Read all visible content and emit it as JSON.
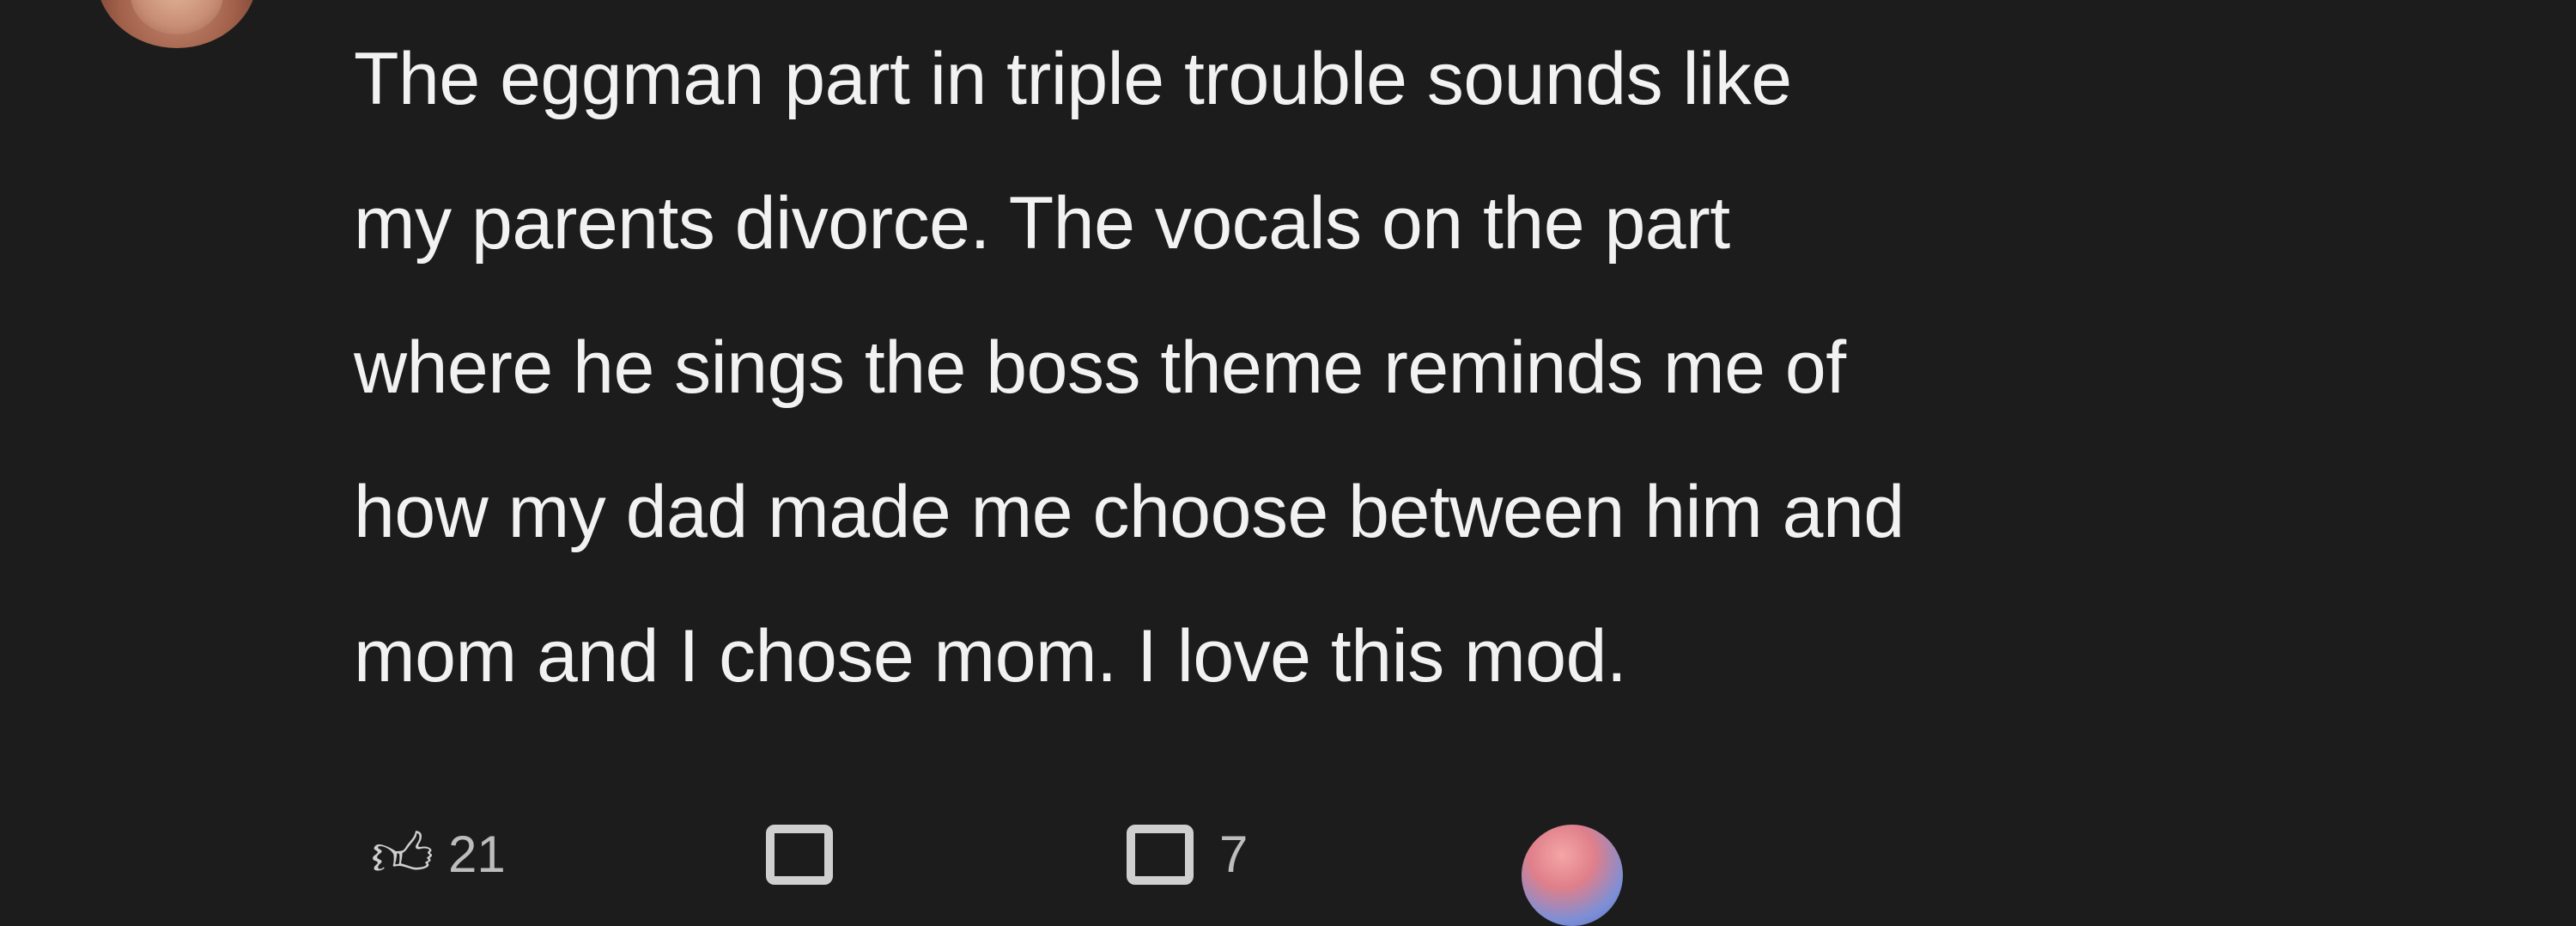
{
  "comment": {
    "lines": [
      "The eggman part in triple trouble sounds like",
      "my parents divorce. The vocals on the part",
      "where he sings the boss theme reminds me of",
      "how my dad made me choose between him and",
      "mom and I chose mom. I love this mod."
    ]
  },
  "actions": {
    "like_icon": "thumbs-up-icon",
    "like_count": "21",
    "reply_icon": "comment-icon",
    "save_icon": "bookmark-icon",
    "save_count": "7"
  },
  "colors": {
    "background": "#1c1c1c",
    "text": "#f2f2f2",
    "secondary_text": "#bdbdbd"
  }
}
